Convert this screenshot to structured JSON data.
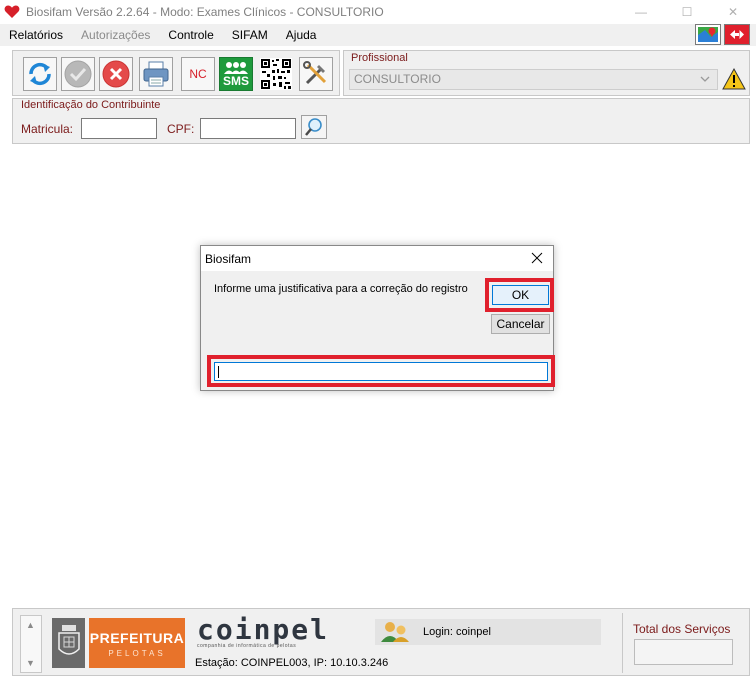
{
  "window": {
    "title": "Biosifam Versão 2.2.64 - Modo: Exames Clínicos - CONSULTORIO",
    "minimize": "—",
    "maximize": "☐",
    "close": "✕"
  },
  "menu": [
    {
      "label": "Relatórios",
      "enabled": true
    },
    {
      "label": "Autorizações",
      "enabled": false
    },
    {
      "label": "Controle",
      "enabled": true
    },
    {
      "label": "SIFAM",
      "enabled": true
    },
    {
      "label": "Ajuda",
      "enabled": true
    }
  ],
  "toolbar": {
    "nc_label": "NC",
    "sms_label": "SMS"
  },
  "profissional": {
    "label": "Profissional",
    "selected": "CONSULTORIO"
  },
  "identificacao": {
    "legend": "Identificação do Contribuinte",
    "matricula_label": "Matricula:",
    "matricula_value": "",
    "cpf_label": "CPF:",
    "cpf_value": ""
  },
  "dialog": {
    "title": "Biosifam",
    "prompt": "Informe uma justificativa para a correção do registro",
    "ok_label": "OK",
    "cancel_label": "Cancelar",
    "input_value": ""
  },
  "footer": {
    "prefeitura_title": "PREFEITURA",
    "prefeitura_sub": "PELOTAS",
    "coinpel_logo": "coinpel",
    "coinpel_sub": "companhia de informática de pelotas",
    "estacao": "Estação: COINPEL003, IP: 10.10.3.246",
    "login": "Login: coinpel",
    "total_label": "Total dos Serviços",
    "total_value": ""
  },
  "colors": {
    "highlight": "#e0202d",
    "label_red": "#7b1a1a",
    "accent_blue": "#0078d7",
    "prefeitura_orange": "#e8732a"
  }
}
